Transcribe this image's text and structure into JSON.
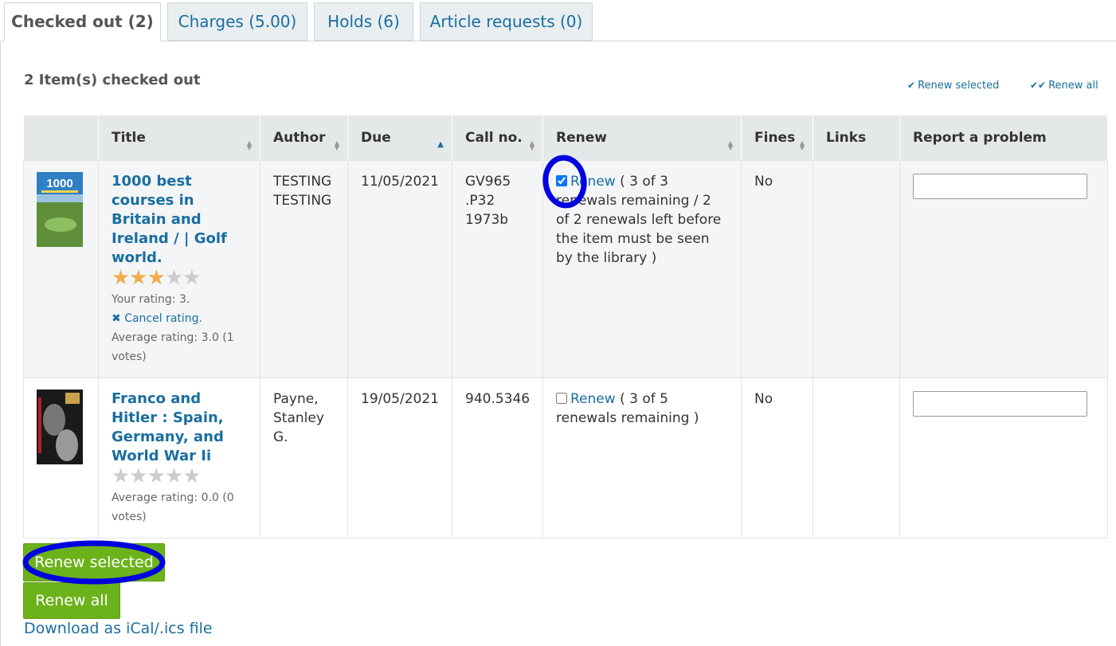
{
  "tabs": [
    {
      "label": "Checked out (2)",
      "active": true
    },
    {
      "label": "Charges (5.00)",
      "active": false
    },
    {
      "label": "Holds (6)",
      "active": false
    },
    {
      "label": "Article requests (0)",
      "active": false
    }
  ],
  "summary": "2 Item(s) checked out",
  "links": {
    "renew_selected": "Renew selected",
    "renew_all": "Renew all"
  },
  "columns": [
    "Title",
    "Author",
    "Due",
    "Call no.",
    "Renew",
    "Fines",
    "Links",
    "Report a problem"
  ],
  "rows": [
    {
      "title": "1000 best courses in Britain and Ireland / | Golf world.",
      "author": "TESTING TESTING",
      "due": "11/05/2021",
      "callno": "GV965 .P32 1973b",
      "renew_label": "Renew",
      "renew_text": "( 3 of 3 renewals remaining / 2 of 2 renewals left before the item must be seen by the library )",
      "renew_checked": true,
      "fines": "No",
      "rating_stars": 3,
      "your_rating": "Your rating: 3.",
      "cancel_rating": "Cancel rating",
      "average": "Average rating: 3.0 (1 votes)",
      "cover_text": "1000"
    },
    {
      "title": "Franco and Hitler : Spain, Germany, and World War Ii",
      "author": "Payne, Stanley G.",
      "due": "19/05/2021",
      "callno": "940.5346",
      "renew_label": "Renew",
      "renew_text": "( 3 of 5 renewals remaining )",
      "renew_checked": false,
      "fines": "No",
      "rating_stars": 0,
      "average": "Average rating: 0.0 (0 votes)"
    }
  ],
  "buttons": {
    "renew_selected": "Renew selected",
    "renew_all": "Renew all"
  },
  "ical_link": "Download as iCal/.ics file",
  "colors": {
    "link": "#1a6ea0",
    "button": "#6cb21b",
    "annotation": "#0000e0",
    "star": "#f0ad4e"
  }
}
